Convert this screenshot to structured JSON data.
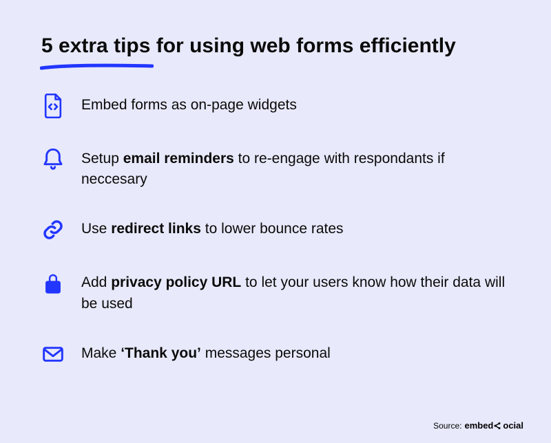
{
  "title": "5 extra tips for using web forms efficiently",
  "tips": [
    {
      "icon": "file-code-icon",
      "text": "Embed forms as on-page widgets"
    },
    {
      "icon": "bell-icon",
      "text": "Setup <b>email reminders</b> to re-engage with respondants if neccesary"
    },
    {
      "icon": "link-icon",
      "text": "Use <b>redirect links</b> to lower bounce rates"
    },
    {
      "icon": "lock-icon",
      "text": "Add <b>privacy policy URL</b> to let your users know how their data will be used"
    },
    {
      "icon": "envelope-icon",
      "text": "Make <b>‘Thank you’</b> messages personal"
    }
  ],
  "source": {
    "label": "Source:",
    "brand_pre": "embed",
    "brand_post": "ocial"
  },
  "colors": {
    "accent": "#2236ff",
    "bg": "#e8e9fa"
  }
}
